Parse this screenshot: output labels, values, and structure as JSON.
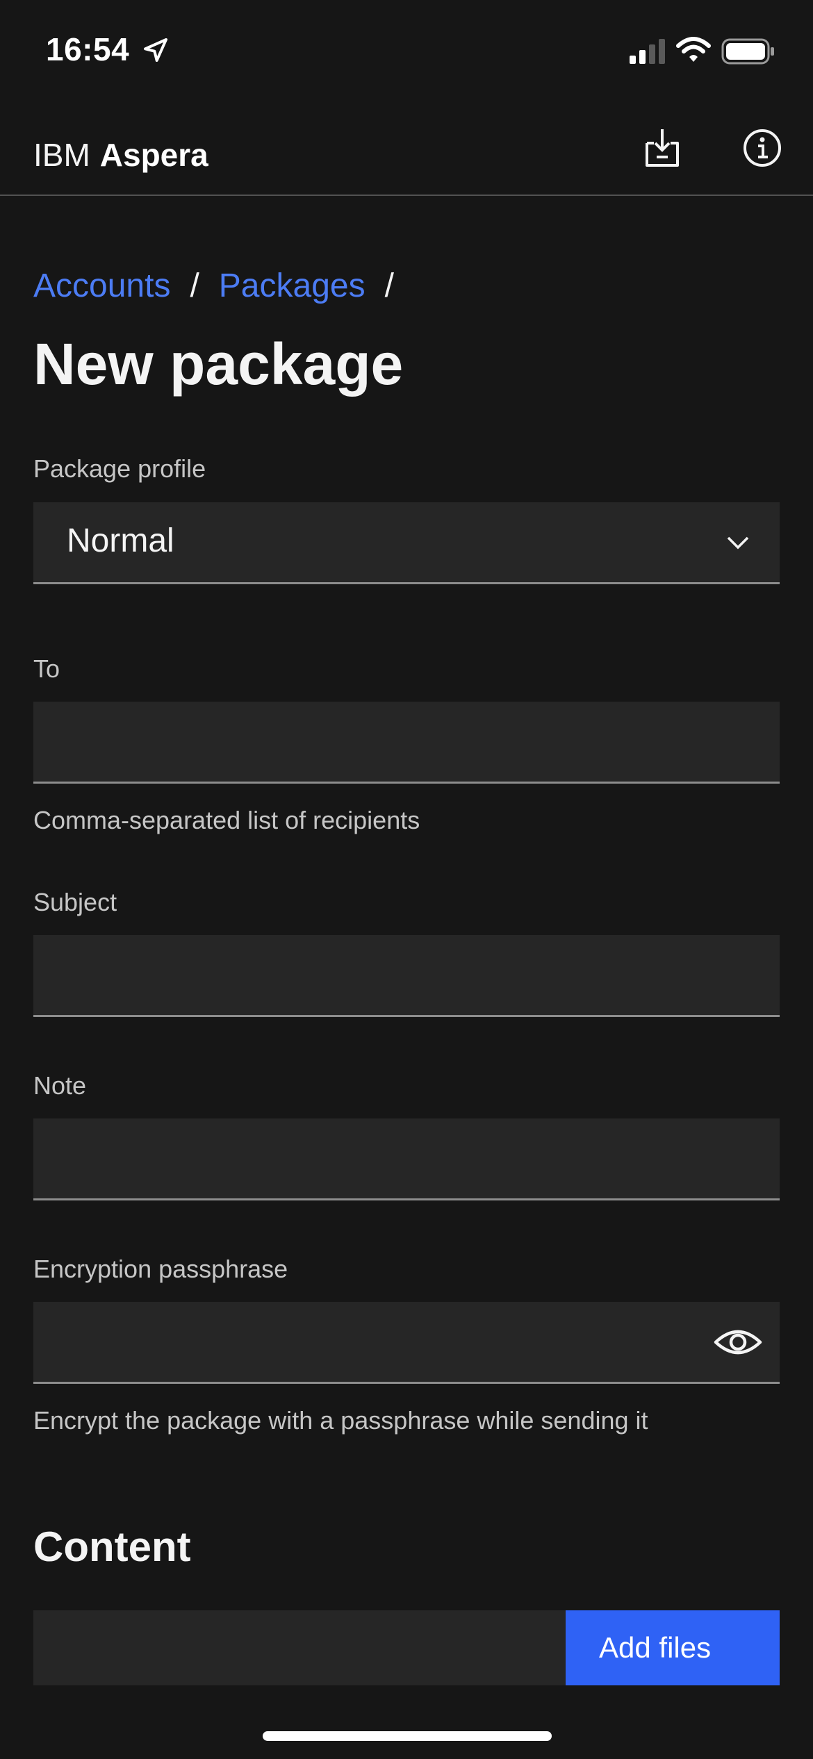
{
  "status_bar": {
    "time": "16:54",
    "icons": [
      "location-arrow-icon",
      "cellular-signal-icon",
      "wifi-icon",
      "battery-icon"
    ]
  },
  "header": {
    "brand_company": "IBM",
    "brand_product": "Aspera",
    "actions": [
      "download-icon",
      "info-icon"
    ]
  },
  "breadcrumb": {
    "items": [
      "Accounts",
      "Packages"
    ],
    "separator": "/"
  },
  "page_title": "New package",
  "form": {
    "package_profile": {
      "label": "Package profile",
      "value": "Normal"
    },
    "to": {
      "label": "To",
      "value": "",
      "helper": "Comma-separated list of recipients"
    },
    "subject": {
      "label": "Subject",
      "value": ""
    },
    "note": {
      "label": "Note",
      "value": ""
    },
    "passphrase": {
      "label": "Encryption passphrase",
      "value": "",
      "helper": "Encrypt the package with a passphrase while sending it"
    }
  },
  "content": {
    "title": "Content",
    "add_files_label": "Add files"
  },
  "colors": {
    "background": "#161616",
    "field": "#262626",
    "link": "#4c7cf4",
    "primary_button": "#2f62f5"
  }
}
